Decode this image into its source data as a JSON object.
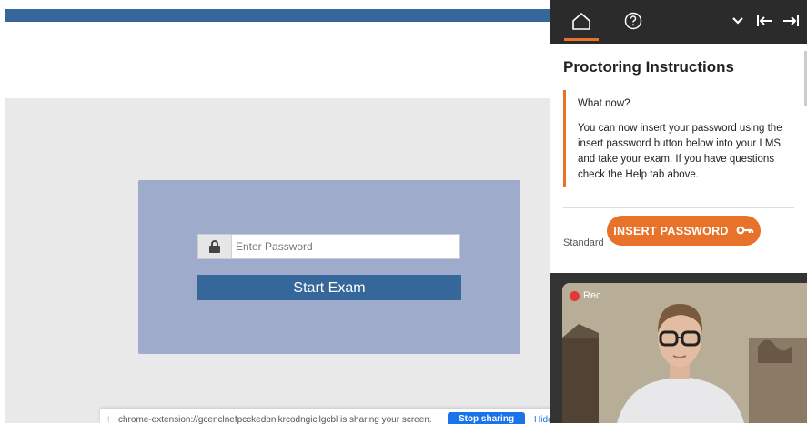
{
  "lms": {
    "password_placeholder": "Enter Password",
    "start_exam_label": "Start Exam"
  },
  "screen_share": {
    "message": "chrome-extension://gcenclnefpcckedpnlkrcodngicllgcbl is sharing your screen.",
    "stop_label": "Stop sharing",
    "hide_label": "Hide"
  },
  "panel": {
    "header_icons": [
      "home-icon",
      "help-circle-icon",
      "chevron-down-icon",
      "collapse-left-icon",
      "expand-right-icon"
    ],
    "title": "Proctoring Instructions",
    "note": {
      "heading": "What now?",
      "body": "You can now insert your password using the insert password button below into your LMS and take your exam. If you have questions check the Help tab above."
    },
    "standard_label": "Standard",
    "insert_password_label": "INSERT PASSWORD",
    "accent_color": "#e8722a"
  },
  "video": {
    "rec_label": "Rec"
  },
  "colors": {
    "lms_blue": "#35679a",
    "card_bg": "#9fabca",
    "panel_header": "#2b2b2b"
  }
}
